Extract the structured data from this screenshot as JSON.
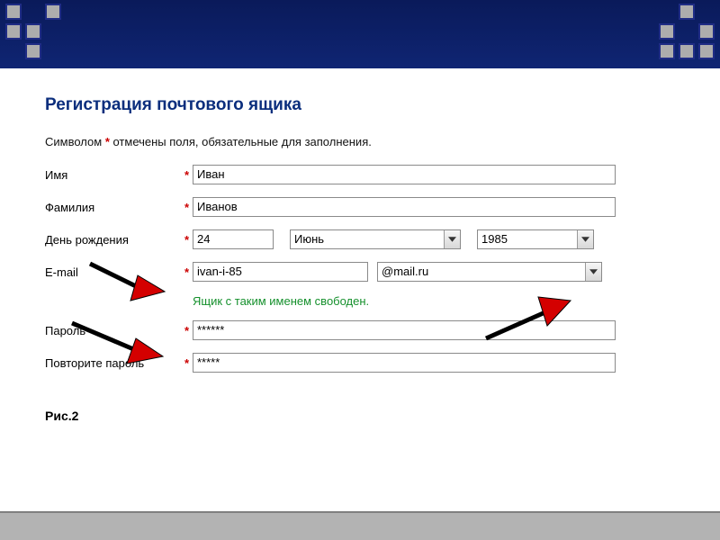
{
  "header": {
    "decoration": "square-grid"
  },
  "title": "Регистрация почтового ящика",
  "note_prefix": "Символом ",
  "note_ast": "*",
  "note_suffix": " отмечены поля, обязательные для заполнения.",
  "fields": {
    "first_name": {
      "label": "Имя",
      "value": "Иван"
    },
    "last_name": {
      "label": "Фамилия",
      "value": "Иванов"
    },
    "birthday": {
      "label": "День рождения",
      "day": "24",
      "month": "Июнь",
      "year": "1985"
    },
    "email": {
      "label": "E-mail",
      "user": "ivan-i-85",
      "domain": "@mail.ru"
    },
    "available_msg": "Ящик с таким именем свободен.",
    "password": {
      "label": "Пароль",
      "value": "******"
    },
    "password2": {
      "label": "Повторите пароль",
      "value": "*****"
    }
  },
  "asterisk": "*",
  "caption": "Рис.2"
}
